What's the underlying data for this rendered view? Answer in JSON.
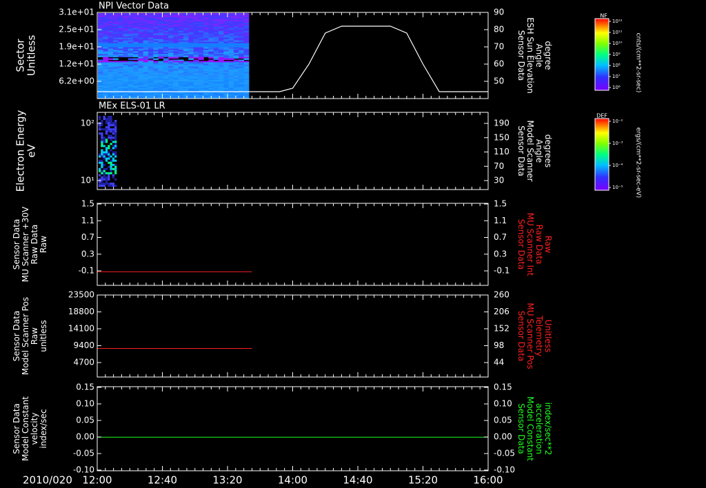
{
  "time_axis": {
    "date_label": "2010/020",
    "ticks": [
      "12:00",
      "12:40",
      "13:20",
      "14:00",
      "14:40",
      "15:20",
      "16:00"
    ]
  },
  "panels": [
    {
      "id": "npi",
      "title": "NPI Vector Data",
      "left_label": [
        "Sector",
        "Unitless"
      ],
      "left_ticks": [
        "3.1e+01",
        "2.5e+01",
        "1.9e+01",
        "1.2e+01",
        "6.2e+00"
      ],
      "right_label": [
        "Sensor Data",
        "ESH Sun Elevation",
        "Angle",
        "degree"
      ],
      "right_label_color": "#ffffff",
      "right_ticks": [
        "90",
        "80",
        "70",
        "60",
        "50"
      ],
      "colorbar": {
        "title": "NF",
        "units": "cnts/(cm**2-sr-sec)",
        "ticks": [
          "10¹²",
          "10¹¹",
          "10¹⁰",
          "10⁹",
          "10⁸",
          "10⁷",
          "10⁶"
        ]
      }
    },
    {
      "id": "els",
      "title": "MEx ELS-01 LR",
      "left_label": [
        "Electron Energy",
        "eV"
      ],
      "left_ticks": [
        "10²",
        "10¹"
      ],
      "right_label": [
        "Sensor Data",
        "Model Scanner",
        "Angle",
        "degrees"
      ],
      "right_label_color": "#ffffff",
      "right_ticks": [
        "190",
        "150",
        "110",
        "70",
        "30"
      ],
      "colorbar": {
        "title": "DEF",
        "units": "ergs/(cm**2-sr-sec-eV)",
        "ticks": [
          "10⁻²",
          "10⁻³",
          "10⁻⁴",
          "10⁻⁵"
        ]
      }
    },
    {
      "id": "mu_int",
      "left_label": [
        "Sensor Data",
        "MU Scanner +30V",
        "Raw Data",
        "Raw"
      ],
      "left_ticks": [
        "1.5",
        "1.1",
        "0.7",
        "0.3",
        "-0.1"
      ],
      "right_label": [
        "Sensor Data",
        "MU Scanner Int",
        "Raw Data",
        "Raw"
      ],
      "right_label_color": "#ff2020",
      "right_ticks": [
        "1.5",
        "1.1",
        "0.7",
        "0.3",
        "-0.1"
      ]
    },
    {
      "id": "mu_pos",
      "left_label": [
        "Sensor Data",
        "Model Scanner Pos",
        "Raw",
        "unitless"
      ],
      "left_ticks": [
        "23500",
        "18800",
        "14100",
        "9400",
        "4700"
      ],
      "right_label": [
        "Sensor Data",
        "MU Scanner Pos",
        "Telemetry",
        "Unitless"
      ],
      "right_label_color": "#ff2020",
      "right_ticks": [
        "260",
        "206",
        "152",
        "98",
        "44"
      ]
    },
    {
      "id": "model_const",
      "left_label": [
        "Sensor Data",
        "Model Constant",
        "velocity",
        "index/sec"
      ],
      "left_ticks": [
        "0.15",
        "0.10",
        "0.05",
        "0.00",
        "-0.05",
        "-0.10"
      ],
      "right_label": [
        "Sensor Data",
        "Model Constant",
        "acceleration",
        "index/sec**2"
      ],
      "right_label_color": "#20ff20",
      "right_ticks": [
        "0.15",
        "0.10",
        "0.05",
        "0.00",
        "-0.05",
        "-0.10"
      ]
    }
  ],
  "chart_data": [
    {
      "type": "heatmap",
      "panel": "npi",
      "x_range": [
        "12:00",
        "16:00"
      ],
      "data_extent": [
        "12:00",
        "13:33"
      ],
      "ylim": [
        0,
        31
      ],
      "line_series": {
        "name": "ESH Sun Elevation Angle",
        "color": "#ffffff",
        "ylim": [
          40,
          90
        ],
        "x": [
          "12:00",
          "13:52",
          "14:00",
          "14:10",
          "14:20",
          "14:30",
          "15:00",
          "15:10",
          "15:20",
          "15:30",
          "16:00"
        ],
        "y": [
          44,
          44,
          46,
          60,
          78,
          82,
          82,
          78,
          60,
          44,
          44
        ]
      }
    },
    {
      "type": "heatmap",
      "panel": "els",
      "x_range": [
        "12:00",
        "16:00"
      ],
      "data_extent": [
        "12:00",
        "12:12"
      ],
      "line_series": {
        "name": "Model Scanner Angle",
        "color": "#ffffff",
        "ylim": [
          10,
          190
        ],
        "x": [
          "12:00",
          "16:00"
        ],
        "y": [
          10,
          10
        ]
      }
    },
    {
      "type": "line",
      "panel": "mu_int",
      "ylim": [
        -0.3,
        1.5
      ],
      "series": [
        {
          "name": "MU Scanner Int Raw Data",
          "color": "#ff2020",
          "x": [
            "12:00",
            "13:35"
          ],
          "y": [
            0.0,
            0.0
          ]
        }
      ]
    },
    {
      "type": "line",
      "panel": "mu_pos",
      "ylim": [
        0,
        23500
      ],
      "series": [
        {
          "name": "Model Scanner Pos",
          "color": "#ff2020",
          "x": [
            "12:00",
            "13:35"
          ],
          "y": [
            8200,
            8200
          ]
        }
      ]
    },
    {
      "type": "line",
      "panel": "model_const",
      "ylim": [
        -0.1,
        0.15
      ],
      "series": [
        {
          "name": "Model Constant velocity",
          "color": "#20ff20",
          "x": [
            "12:00",
            "16:00"
          ],
          "y": [
            0.0,
            0.0
          ]
        }
      ]
    }
  ]
}
